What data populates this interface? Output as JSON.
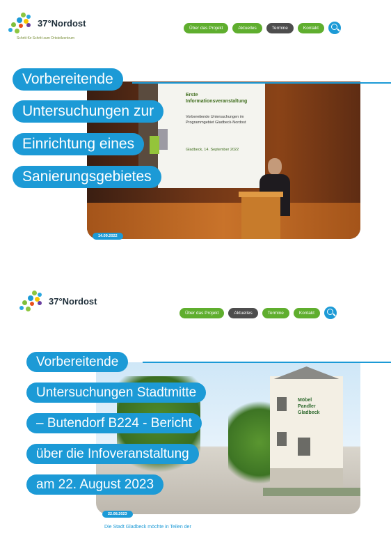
{
  "brand": {
    "name": "37°Nordost"
  },
  "header1": {
    "subtitle": "Schritt für Schritt zum Ortsteilzentrum",
    "nav": [
      "Über das Projekt",
      "Aktuelles",
      "Termine",
      "Kontakt"
    ]
  },
  "article1": {
    "title_lines": [
      "Vorbereitende",
      "Untersuchungen zur",
      "Einrichtung eines",
      "Sanierungsgebietes"
    ],
    "date": "14.09.2022",
    "slide": {
      "heading": "Erste Informationsveranstaltung",
      "body": "Vorbereitende Untersuchungen im Programmgebiet Gladbeck-Nordost",
      "date": "Gladbeck, 14. September 2022"
    }
  },
  "header2": {
    "nav": [
      "Über das Projekt",
      "Aktuelles",
      "Termine",
      "Kontakt"
    ]
  },
  "article2": {
    "title_lines": [
      "Vorbereitende",
      "Untersuchungen Stadtmitte",
      "– Butendorf B224 - Bericht",
      "über die Infoveranstaltung",
      "am 22. August 2023"
    ],
    "date": "22.08.2023",
    "building_sign": "Möbel Pandler Gladbeck",
    "teaser": "Die Stadt Gladbeck möchte in Teilen der"
  },
  "colors": {
    "accent_blue": "#1c9ad6",
    "nav_green": "#5fae2e",
    "nav_dark": "#4d4d4d"
  },
  "icons": {
    "search": "search-icon",
    "logo": "leaf-cluster-logo"
  }
}
